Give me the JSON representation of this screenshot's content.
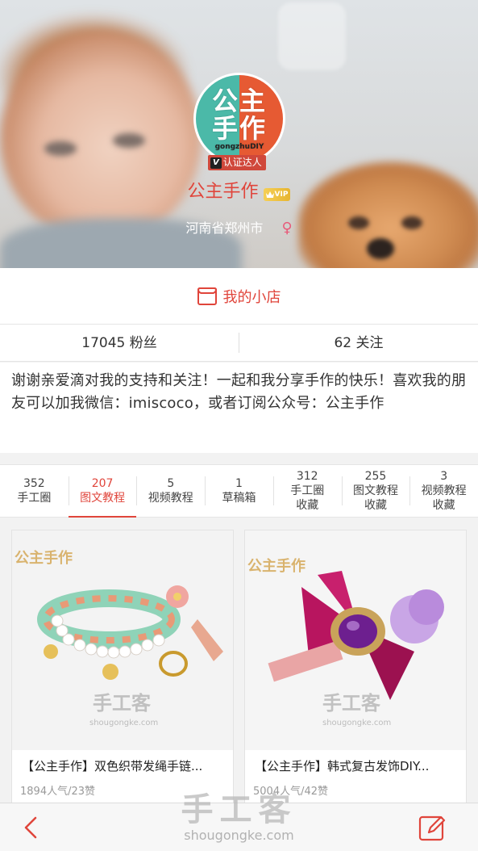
{
  "profile": {
    "avatar_text": "公主\n手作",
    "avatar_sub": "gongzhuDIY",
    "badge_v": "V",
    "badge_label": "认证达人",
    "username": "公主手作",
    "vip_label": "VIP",
    "location": "河南省郑州市",
    "gender_symbol": "♀"
  },
  "shop": {
    "label": "我的小店",
    "icon": "shop-icon"
  },
  "stats": {
    "fans": "17045 粉丝",
    "following": "62 关注"
  },
  "bio": "谢谢亲爱滴对我的支持和关注！一起和我分享手作的快乐！喜欢我的朋友可以加我微信：imiscoco，或者订阅公众号：公主手作",
  "tabs": [
    {
      "count": "352",
      "label": "手工圈",
      "label2": ""
    },
    {
      "count": "207",
      "label": "图文教程",
      "label2": ""
    },
    {
      "count": "5",
      "label": "视频教程",
      "label2": ""
    },
    {
      "count": "1",
      "label": "草稿箱",
      "label2": ""
    },
    {
      "count": "312",
      "label": "手工圈",
      "label2": "收藏"
    },
    {
      "count": "255",
      "label": "图文教程",
      "label2": "收藏"
    },
    {
      "count": "3",
      "label": "视频教程",
      "label2": "收藏"
    }
  ],
  "active_tab_index": 1,
  "cards": [
    {
      "title": "【公主手作】双色织带发绳手链...",
      "meta": "1894人气/23赞",
      "logo": "公主手作",
      "watermark": "手工客",
      "watermark_sub": "shougongke.com"
    },
    {
      "title": "【公主手作】韩式复古发饰DIY...",
      "meta": "5004人气/42赞",
      "logo": "公主手作",
      "watermark": "手工客",
      "watermark_sub": "shougongke.com"
    }
  ],
  "bottom": {
    "back_icon": "chevron-left-icon",
    "edit_icon": "edit-icon",
    "watermark": "手工客",
    "watermark_sub": "shougongke.com"
  },
  "colors": {
    "accent": "#e0453b",
    "teal": "#4bb9a8",
    "orange": "#e65a33",
    "gender": "#e85b7a"
  }
}
